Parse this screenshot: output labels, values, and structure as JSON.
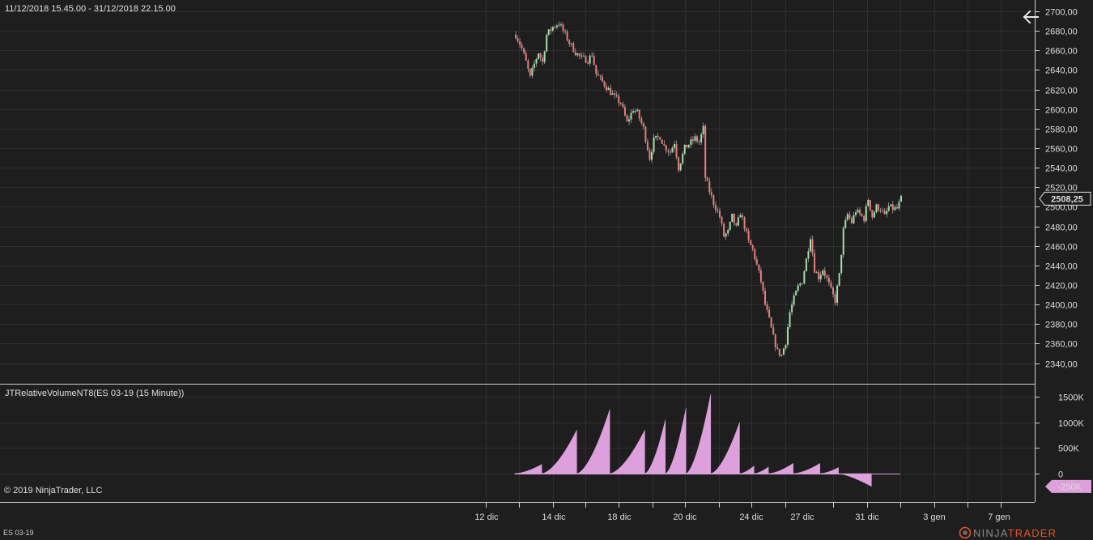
{
  "header": {
    "date_range": "11/12/2018 15.45.00 - 31/12/2018 22.15.00"
  },
  "indicator": {
    "title": "JTRelativeVolumeNT8(ES 03-19 (15 Minute))"
  },
  "footer": {
    "copyright": "© 2019 NinjaTrader, LLC",
    "instrument": "ES 03-19",
    "brand_left": "NINJA",
    "brand_right": "TRADER"
  },
  "colors": {
    "background": "#1e1e1e",
    "grid": "#2e2e2e",
    "up_candle": "#9fe0a8",
    "down_candle": "#f07a7a",
    "volume_fill": "#dda0dd",
    "brand_accent": "#e8531e"
  },
  "chart_data": [
    {
      "type": "candlestick",
      "y_axis_ticks": [
        "2700,00",
        "2680,00",
        "2660,00",
        "2640,00",
        "2620,00",
        "2600,00",
        "2580,00",
        "2560,00",
        "2540,00",
        "2520,00",
        "2500,00",
        "2480,00",
        "2460,00",
        "2440,00",
        "2420,00",
        "2400,00",
        "2380,00",
        "2360,00",
        "2340,00"
      ],
      "ylim": [
        2330,
        2710
      ],
      "x_axis_labels": [
        "12 dic",
        "14 dic",
        "18 dic",
        "20 dic",
        "24 dic",
        "27 dic",
        "31 dic",
        "3 gen",
        "7 gen"
      ],
      "last_price_label": "2508,25",
      "last_price": 2508.25,
      "close_path": [
        [
          0,
          2676
        ],
        [
          3,
          2662
        ],
        [
          5,
          2648
        ],
        [
          7,
          2632
        ],
        [
          9,
          2646
        ],
        [
          11,
          2658
        ],
        [
          13,
          2648
        ],
        [
          15,
          2676
        ],
        [
          18,
          2684
        ],
        [
          21,
          2688
        ],
        [
          23,
          2680
        ],
        [
          26,
          2668
        ],
        [
          29,
          2658
        ],
        [
          32,
          2652
        ],
        [
          35,
          2650
        ],
        [
          37,
          2656
        ],
        [
          39,
          2636
        ],
        [
          42,
          2628
        ],
        [
          45,
          2620
        ],
        [
          48,
          2612
        ],
        [
          51,
          2606
        ],
        [
          54,
          2586
        ],
        [
          57,
          2600
        ],
        [
          59,
          2596
        ],
        [
          62,
          2580
        ],
        [
          65,
          2550
        ],
        [
          67,
          2568
        ],
        [
          70,
          2572
        ],
        [
          72,
          2562
        ],
        [
          75,
          2556
        ],
        [
          77,
          2566
        ],
        [
          79,
          2540
        ],
        [
          82,
          2560
        ],
        [
          85,
          2566
        ],
        [
          87,
          2570
        ],
        [
          89,
          2566
        ],
        [
          91,
          2580
        ],
        [
          92,
          2530
        ],
        [
          94,
          2516
        ],
        [
          96,
          2504
        ],
        [
          99,
          2490
        ],
        [
          101,
          2470
        ],
        [
          103,
          2474
        ],
        [
          105,
          2490
        ],
        [
          107,
          2478
        ],
        [
          109,
          2494
        ],
        [
          111,
          2480
        ],
        [
          113,
          2464
        ],
        [
          115,
          2456
        ],
        [
          117,
          2440
        ],
        [
          119,
          2424
        ],
        [
          121,
          2400
        ],
        [
          123,
          2384
        ],
        [
          125,
          2366
        ],
        [
          127,
          2352
        ],
        [
          129,
          2348
        ],
        [
          131,
          2362
        ],
        [
          133,
          2392
        ],
        [
          135,
          2406
        ],
        [
          137,
          2418
        ],
        [
          139,
          2424
        ],
        [
          141,
          2446
        ],
        [
          143,
          2470
        ],
        [
          145,
          2436
        ],
        [
          147,
          2428
        ],
        [
          149,
          2436
        ],
        [
          151,
          2426
        ],
        [
          153,
          2414
        ],
        [
          155,
          2404
        ],
        [
          157,
          2430
        ],
        [
          159,
          2476
        ],
        [
          161,
          2492
        ],
        [
          163,
          2484
        ],
        [
          165,
          2496
        ],
        [
          167,
          2492
        ],
        [
          169,
          2488
        ],
        [
          171,
          2508
        ],
        [
          173,
          2490
        ],
        [
          175,
          2500
        ],
        [
          177,
          2498
        ],
        [
          179,
          2490
        ],
        [
          181,
          2500
        ],
        [
          183,
          2498
        ],
        [
          185,
          2498
        ],
        [
          187,
          2508
        ]
      ]
    },
    {
      "type": "area",
      "name": "JTRelativeVolumeNT8(ES 03-19 (15 Minute))",
      "y_axis_ticks": [
        "1500K",
        "1000K",
        "500K",
        "0"
      ],
      "ylim": [
        -380000,
        1700000
      ],
      "last_value_label": "-250K",
      "last_value": -250000,
      "segments": [
        {
          "start": 0,
          "end": 13,
          "peak": 180000
        },
        {
          "start": 13,
          "end": 30,
          "peak": 850000
        },
        {
          "start": 30,
          "end": 46,
          "peak": 1250000
        },
        {
          "start": 46,
          "end": 63,
          "peak": 850000
        },
        {
          "start": 63,
          "end": 73,
          "peak": 1050000
        },
        {
          "start": 73,
          "end": 83,
          "peak": 1280000
        },
        {
          "start": 83,
          "end": 95,
          "peak": 1550000
        },
        {
          "start": 95,
          "end": 109,
          "peak": 1000000
        },
        {
          "start": 109,
          "end": 116,
          "peak": 150000
        },
        {
          "start": 116,
          "end": 123,
          "peak": 130000
        },
        {
          "start": 123,
          "end": 135,
          "peak": 200000
        },
        {
          "start": 135,
          "end": 148,
          "peak": 200000
        },
        {
          "start": 148,
          "end": 157,
          "peak": 120000
        },
        {
          "start": 157,
          "end": 173,
          "peak": -250000
        }
      ]
    }
  ]
}
